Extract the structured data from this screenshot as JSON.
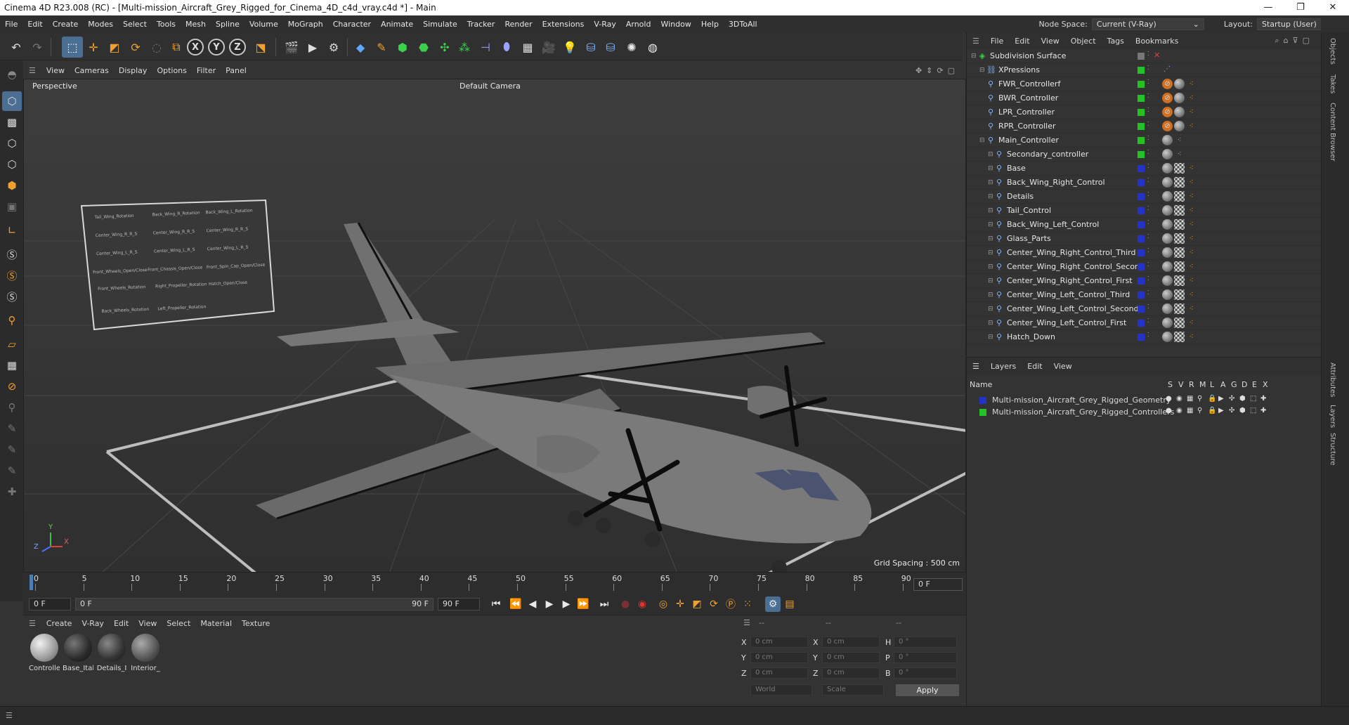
{
  "window": {
    "title": "Cinema 4D R23.008 (RC) - [Multi-mission_Aircraft_Grey_Rigged_for_Cinema_4D_c4d_vray.c4d *] - Main",
    "controls": [
      "—",
      "❐",
      "✕"
    ]
  },
  "menubar": {
    "items": [
      "File",
      "Edit",
      "Create",
      "Modes",
      "Select",
      "Tools",
      "Mesh",
      "Spline",
      "Volume",
      "MoGraph",
      "Character",
      "Animate",
      "Simulate",
      "Tracker",
      "Render",
      "Extensions",
      "V-Ray",
      "Arnold",
      "Window",
      "Help",
      "3DToAll"
    ],
    "node_space_label": "Node Space:",
    "node_space_value": "Current (V-Ray)",
    "layout_label": "Layout:",
    "layout_value": "Startup (User)"
  },
  "toolbar": {
    "axis_x": "X",
    "axis_y": "Y",
    "axis_z": "Z"
  },
  "viewport": {
    "menu": [
      "View",
      "Cameras",
      "Display",
      "Options",
      "Filter",
      "Panel"
    ],
    "view_name": "Perspective",
    "camera": "Default Camera",
    "grid_spacing": "Grid Spacing : 500 cm",
    "axis_x": "X",
    "axis_y": "Y",
    "axis_z": "Z",
    "rig_panel": {
      "labels": [
        "Tail_Wing_Rotation",
        "Back_Wing_R_Rotation",
        "Back_Wing_L_Rotation",
        "Center_Wing_R_R_S",
        "Center_Wing_R_R_S",
        "Center_Wing_R_R_S",
        "Center_Wing_L_R_S",
        "Center_Wing_L_R_S",
        "Center_Wing_L_R_S",
        "Front_Wheels_Open/Close",
        "Front_Chassis_Open/Close",
        "Front_Spin_Cap_Open/Close",
        "Front_Wheels_Rotation",
        "Right_Propeller_Rotation",
        "Hatch_Open/Close",
        "Back_Wheels_Rotation",
        "Left_Propeller_Rotation"
      ]
    }
  },
  "timeline": {
    "ticks": [
      "0",
      "5",
      "10",
      "15",
      "20",
      "25",
      "30",
      "35",
      "40",
      "45",
      "50",
      "55",
      "60",
      "65",
      "70",
      "75",
      "80",
      "85",
      "90"
    ],
    "current_frame": "0 F"
  },
  "transport": {
    "start": "0 F",
    "range_start": "0 F",
    "range_end": "90 F",
    "end": "90 F"
  },
  "materials": {
    "menu": [
      "Create",
      "V-Ray",
      "Edit",
      "View",
      "Select",
      "Material",
      "Texture"
    ],
    "items": [
      {
        "label": "Controlle",
        "color": "#cfcfcf"
      },
      {
        "label": "Base_Ital",
        "color": "#3a3a3a"
      },
      {
        "label": "Details_I",
        "color": "#454545"
      },
      {
        "label": "Interior_",
        "color": "#6a6a6a"
      }
    ]
  },
  "coordinates": {
    "header": [
      "--",
      "--",
      "--"
    ],
    "rows": [
      {
        "axis1": "X",
        "v1": "0 cm",
        "axis2": "X",
        "v2": "0 cm",
        "axis3": "H",
        "v3": "0 °"
      },
      {
        "axis1": "Y",
        "v1": "0 cm",
        "axis2": "Y",
        "v2": "0 cm",
        "axis3": "P",
        "v3": "0 °"
      },
      {
        "axis1": "Z",
        "v1": "0 cm",
        "axis2": "Z",
        "v2": "0 cm",
        "axis3": "B",
        "v3": "0 °"
      }
    ],
    "space": "World",
    "mode": "Scale",
    "apply": "Apply"
  },
  "objects": {
    "menu": [
      "File",
      "Edit",
      "View",
      "Object",
      "Tags",
      "Bookmarks"
    ],
    "items": [
      {
        "name": "Subdivision Surface",
        "indent": 0,
        "color": "#777777"
      },
      {
        "name": "XPressions",
        "indent": 1,
        "color": "#22c322"
      },
      {
        "name": "FWR_Controllerf",
        "indent": 1,
        "color": "#22c322"
      },
      {
        "name": "BWR_Controller",
        "indent": 1,
        "color": "#22c322"
      },
      {
        "name": "LPR_Controller",
        "indent": 1,
        "color": "#22c322"
      },
      {
        "name": "RPR_Controller",
        "indent": 1,
        "color": "#22c322"
      },
      {
        "name": "Main_Controller",
        "indent": 1,
        "color": "#22c322"
      },
      {
        "name": "Secondary_controller",
        "indent": 2,
        "color": "#22c322"
      },
      {
        "name": "Base",
        "indent": 2,
        "color": "#2233c8"
      },
      {
        "name": "Back_Wing_Right_Control",
        "indent": 2,
        "color": "#2233c8"
      },
      {
        "name": "Details",
        "indent": 2,
        "color": "#2233c8"
      },
      {
        "name": "Tail_Control",
        "indent": 2,
        "color": "#2233c8"
      },
      {
        "name": "Back_Wing_Left_Control",
        "indent": 2,
        "color": "#2233c8"
      },
      {
        "name": "Glass_Parts",
        "indent": 2,
        "color": "#2233c8"
      },
      {
        "name": "Center_Wing_Right_Control_Third",
        "indent": 2,
        "color": "#2233c8"
      },
      {
        "name": "Center_Wing_Right_Control_Second",
        "indent": 2,
        "color": "#2233c8"
      },
      {
        "name": "Center_Wing_Right_Control_First",
        "indent": 2,
        "color": "#2233c8"
      },
      {
        "name": "Center_Wing_Left_Control_Third",
        "indent": 2,
        "color": "#2233c8"
      },
      {
        "name": "Center_Wing_Left_Control_Second",
        "indent": 2,
        "color": "#2233c8"
      },
      {
        "name": "Center_Wing_Left_Control_First",
        "indent": 2,
        "color": "#2233c8"
      },
      {
        "name": "Hatch_Down",
        "indent": 2,
        "color": "#2233c8"
      }
    ]
  },
  "layers": {
    "menu": [
      "Layers",
      "Edit",
      "View"
    ],
    "name_header": "Name",
    "columns": [
      "S",
      "V",
      "R",
      "M",
      "L",
      "A",
      "G",
      "D",
      "E",
      "X"
    ],
    "items": [
      {
        "name": "Multi-mission_Aircraft_Grey_Rigged_Geometry",
        "color": "#2233c8"
      },
      {
        "name": "Multi-mission_Aircraft_Grey_Rigged_Controllers",
        "color": "#22c322"
      }
    ]
  },
  "side_tabs": [
    "Objects",
    "Takes",
    "Content Browser",
    "Attributes",
    "Layers",
    "Structure"
  ]
}
